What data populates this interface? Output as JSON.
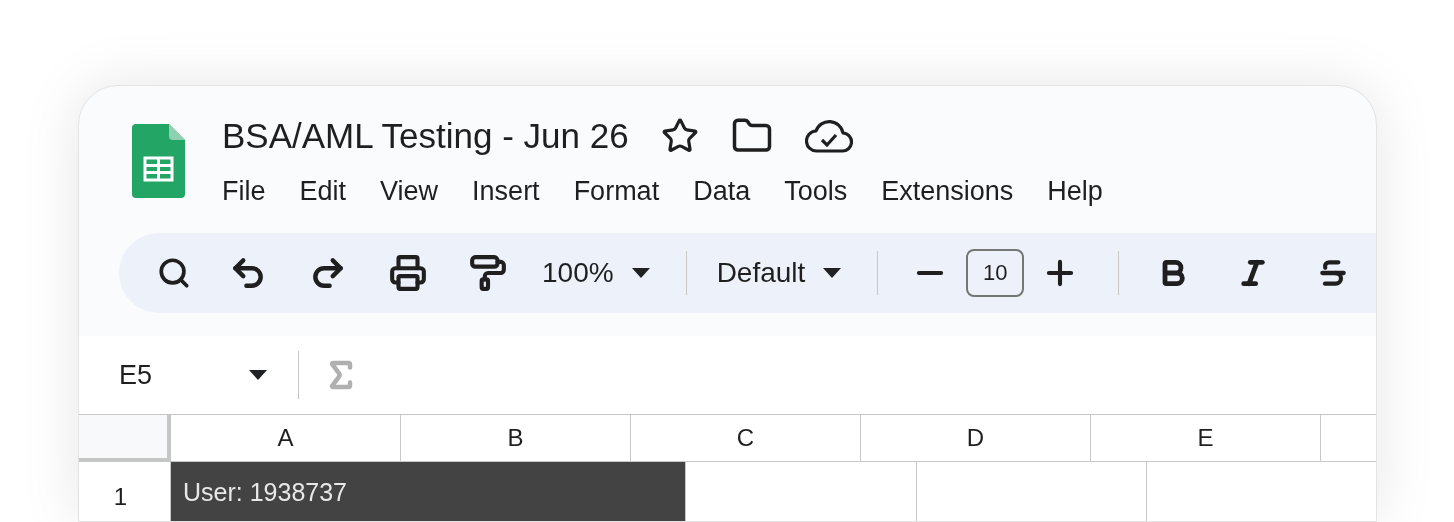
{
  "document": {
    "title": "BSA/AML Testing - Jun 26"
  },
  "menu": [
    "File",
    "Edit",
    "View",
    "Insert",
    "Format",
    "Data",
    "Tools",
    "Extensions",
    "Help"
  ],
  "toolbar": {
    "zoom": "100%",
    "font": "Default",
    "font_size": "10"
  },
  "formula_bar": {
    "cell_ref": "E5"
  },
  "columns": [
    "A",
    "B",
    "C",
    "D",
    "E"
  ],
  "rows": [
    {
      "header": "1",
      "cells": [
        {
          "text": "User: 1938737",
          "kind": "dark"
        }
      ]
    }
  ]
}
